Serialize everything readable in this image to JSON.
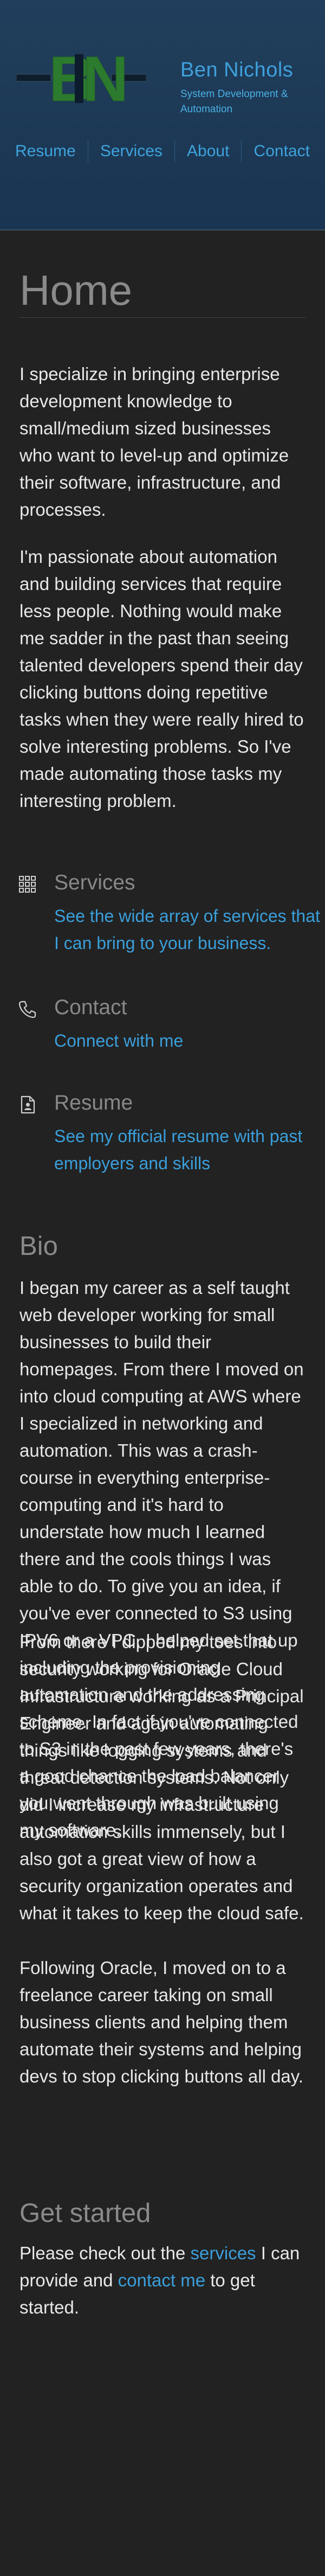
{
  "header": {
    "logo_alt": "BN",
    "brand_name": "Ben Nichols",
    "tagline": "System Development & Automation",
    "colors": {
      "logo_green": "#2c7a2e",
      "logo_dark": "#0c1c2c",
      "brand_blue": "#3fa0dc"
    }
  },
  "nav": {
    "items": [
      {
        "label": "Resume"
      },
      {
        "label": "Services"
      },
      {
        "label": "About"
      },
      {
        "label": "Contact"
      }
    ]
  },
  "home": {
    "title": "Home",
    "intro": [
      "I specialize in bringing enterprise development knowledge to small/medium sized businesses who want to level-up and optimize their software, infrastructure, and processes.",
      "I'm passionate about automation and building services that require less people. Nothing would make me sadder in the past than seeing talented developers spend their day clicking buttons doing repetitive tasks when they were really hired to solve interesting problems. So I've made automating those tasks my interesting problem."
    ]
  },
  "features": [
    {
      "icon": "grid-icon",
      "title": "Services",
      "link": "See the wide array of services that I can bring to your business."
    },
    {
      "icon": "phone-icon",
      "title": "Contact",
      "link": "Connect with me"
    },
    {
      "icon": "document-icon",
      "title": "Resume",
      "link": "See my official resume with past employers and skills"
    }
  ],
  "bio": {
    "title": "Bio",
    "paragraphs": [
      "I began my career as a self taught web developer working for small businesses to build their homepages. From there I moved on into cloud computing at AWS where I specialized in networking and automation. This was a crash-course in everything enterprise-computing and it's hard to understate how much I learned there and the cools things I was able to do. To give you an idea, if you've ever connected to S3 using IPV6 or a VPC, I helped set that up including the provisioning automation and the addressing scheme. In fact if you've connected to S3 in the past few years, there's a good chance the load balancer you went through was built using my software.",
      "From there I dipped my toes into security working for Oracle Cloud Infrastructure working as a Principal Engineer and again automating things like logging systems and threat detection systems. Not only did I increase my infrastructure automation skills immensely, but I also got a great view of how a security organization operates and what it takes to keep the cloud safe.",
      "Following Oracle, I moved on to a freelance career taking on small business clients and helping them automate their systems and helping devs to stop clicking buttons all day."
    ]
  },
  "get_started": {
    "title": "Get started",
    "text_before": "Please check out the ",
    "services_link": "services",
    "text_middle": " I can provide and ",
    "contact_link": "contact me",
    "text_after": " to get started."
  }
}
